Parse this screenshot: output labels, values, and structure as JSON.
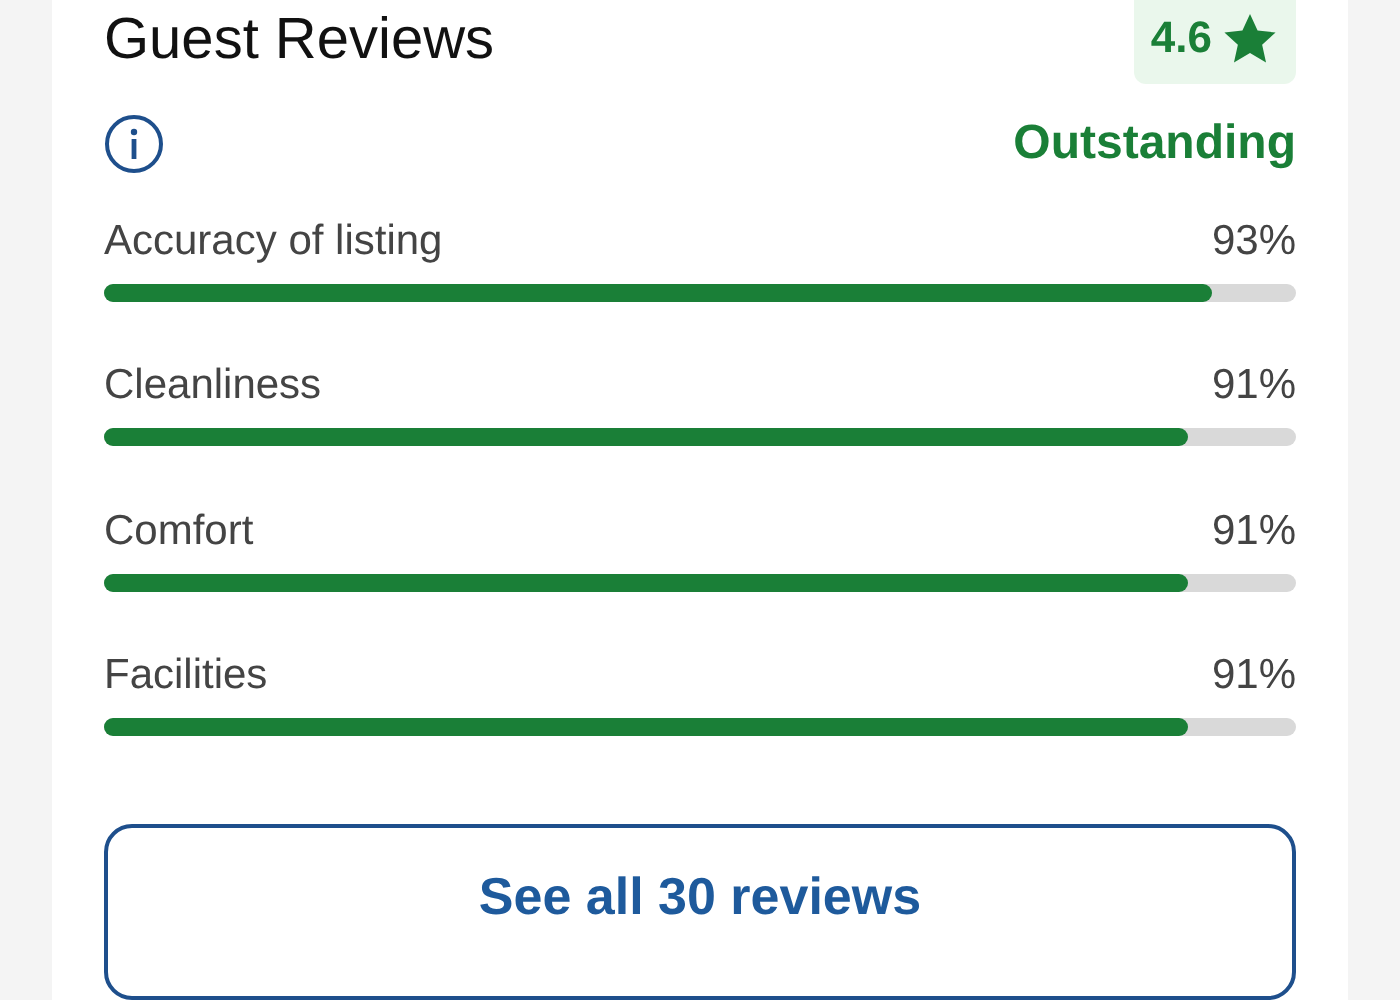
{
  "title": "Guest Reviews",
  "rating": {
    "score": "4.6",
    "verdict": "Outstanding"
  },
  "categories": [
    {
      "name": "Accuracy of listing",
      "percent": "93%",
      "level": 0.93
    },
    {
      "name": "Cleanliness",
      "percent": "91%",
      "level": 0.91
    },
    {
      "name": "Comfort",
      "percent": "91%",
      "level": 0.91
    },
    {
      "name": "Facilities",
      "percent": "91%",
      "level": 0.91
    }
  ],
  "button": "See all 30 reviews"
}
